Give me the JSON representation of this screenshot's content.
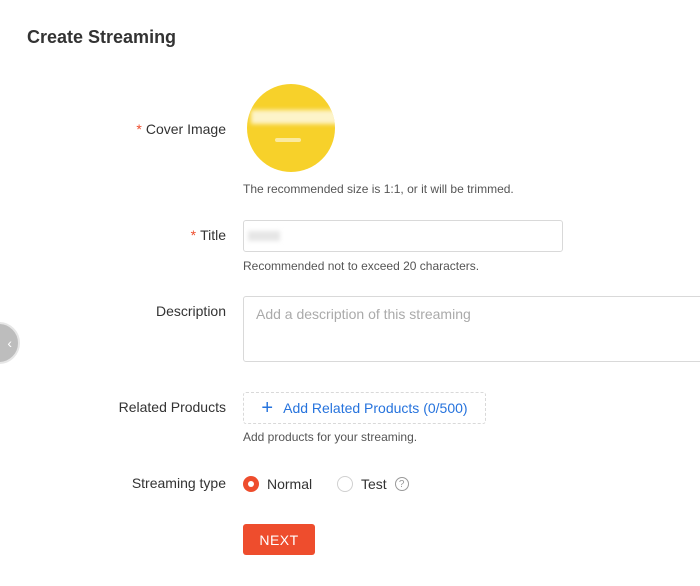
{
  "page": {
    "title": "Create Streaming"
  },
  "cover": {
    "label": "Cover Image",
    "required_mark": "*",
    "hint": "The recommended size is 1:1, or it will be trimmed."
  },
  "title_field": {
    "label": "Title",
    "required_mark": "*",
    "value": "",
    "hint": "Recommended not to exceed 20 characters."
  },
  "description": {
    "label": "Description",
    "placeholder": "Add a description of this streaming"
  },
  "related_products": {
    "label": "Related Products",
    "button_label": "Add Related Products (0/500)",
    "hint": "Add products for your streaming."
  },
  "streaming_type": {
    "label": "Streaming type",
    "options": [
      {
        "label": "Normal",
        "selected": true
      },
      {
        "label": "Test",
        "selected": false
      }
    ],
    "help_glyph": "?"
  },
  "actions": {
    "next_label": "NEXT"
  },
  "side_toggle": {
    "glyph": "‹"
  },
  "colors": {
    "accent": "#ee4d2d",
    "link": "#2673dd",
    "cover_bg": "#f7d12a"
  }
}
